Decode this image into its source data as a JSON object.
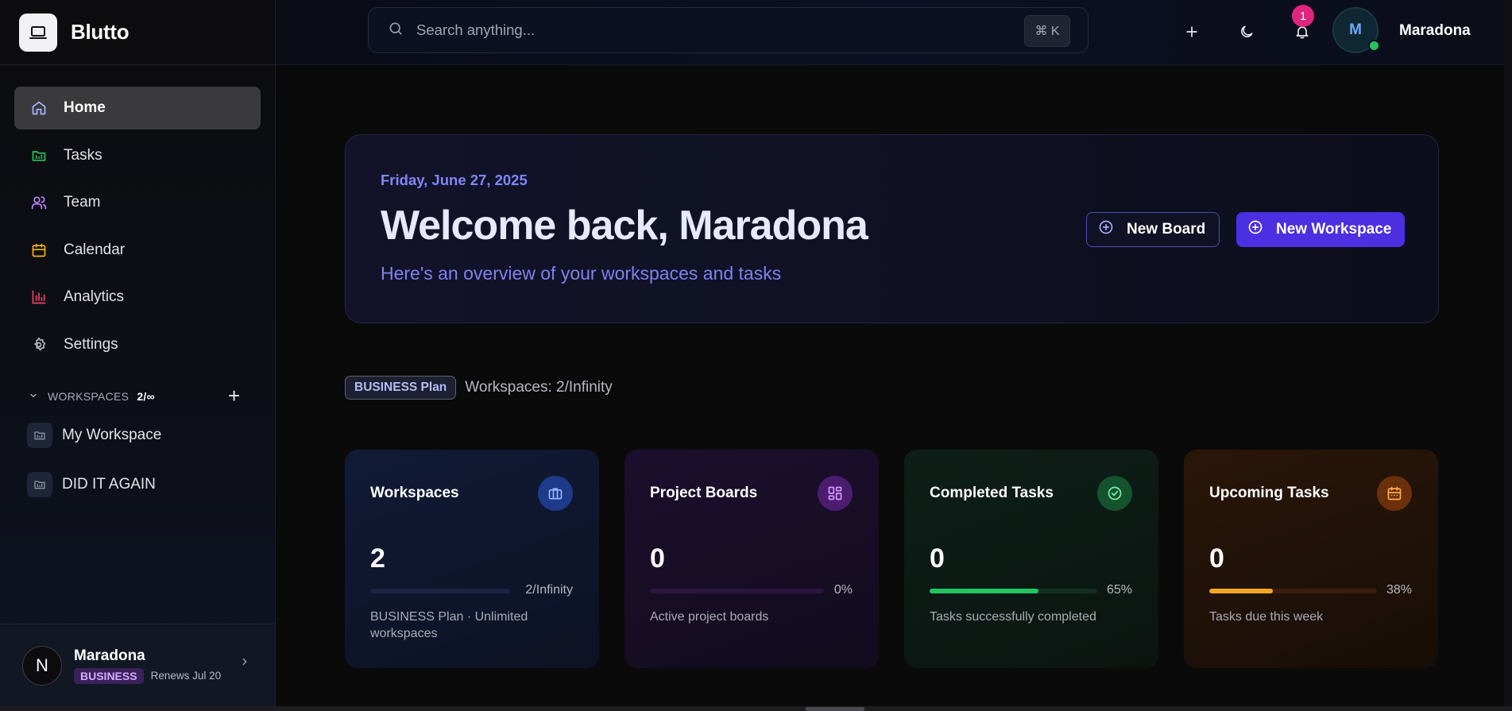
{
  "brand": {
    "name": "Blutto"
  },
  "nav": [
    {
      "label": "Home",
      "icon": "home-icon"
    },
    {
      "label": "Tasks",
      "icon": "tasks-icon"
    },
    {
      "label": "Team",
      "icon": "team-icon"
    },
    {
      "label": "Calendar",
      "icon": "calendar-icon"
    },
    {
      "label": "Analytics",
      "icon": "analytics-icon"
    },
    {
      "label": "Settings",
      "icon": "gear-icon"
    }
  ],
  "workspaces": {
    "header": "WORKSPACES",
    "count": "2/∞",
    "items": [
      {
        "label": "My Workspace"
      },
      {
        "label": "DID IT AGAIN"
      }
    ]
  },
  "user_card": {
    "avatar_letter": "N",
    "name": "Maradona",
    "plan": "BUSINESS",
    "renews": "Renews Jul 20"
  },
  "topbar": {
    "search_placeholder": "Search anything...",
    "shortcut": "⌘ K",
    "notification_count": "1",
    "avatar_letter": "M",
    "user_name": "Maradona"
  },
  "welcome": {
    "date": "Friday, June 27, 2025",
    "title": "Welcome back, Maradona",
    "subtitle": "Here's an overview of your workspaces and tasks",
    "new_board_label": "New Board",
    "new_workspace_label": "New Workspace"
  },
  "plan": {
    "badge": "BUSINESS Plan",
    "workspaces_text": "Workspaces: 2/Infinity"
  },
  "cards": [
    {
      "title": "Workspaces",
      "value": "2",
      "progress": 0.0,
      "progress_label": "2/Infinity",
      "desc": "BUSINESS Plan · Unlimited workspaces",
      "color": "#3b5bdb"
    },
    {
      "title": "Project Boards",
      "value": "0",
      "progress": 0.0,
      "progress_label": "0%",
      "desc": "Active project boards",
      "color": "#a855f7"
    },
    {
      "title": "Completed Tasks",
      "value": "0",
      "progress": 0.65,
      "progress_label": "65%",
      "desc": "Tasks successfully completed",
      "color": "#22c55e"
    },
    {
      "title": "Upcoming Tasks",
      "value": "0",
      "progress": 0.38,
      "progress_label": "38%",
      "desc": "Tasks due this week",
      "color": "#f5a524"
    }
  ],
  "colors": {
    "accent": "#4b2fe0",
    "accent_text": "#7f87f7",
    "online": "#22c55e",
    "notification": "#e0267c"
  }
}
